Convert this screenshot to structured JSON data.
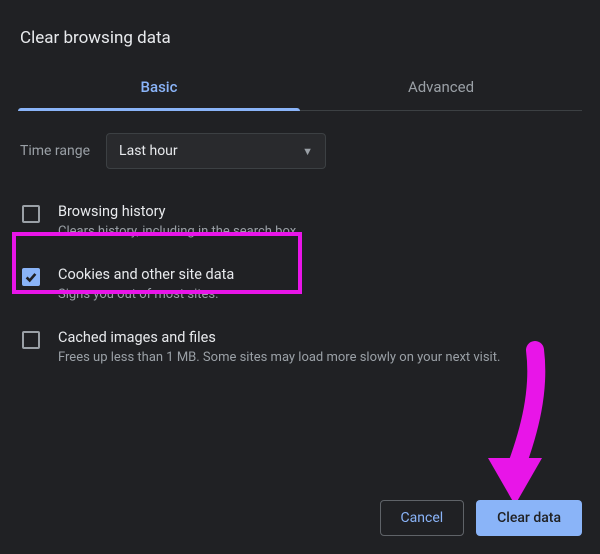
{
  "dialog": {
    "title": "Clear browsing data",
    "tabs": {
      "basic": "Basic",
      "advanced": "Advanced",
      "active": "basic"
    },
    "time_range": {
      "label": "Time range",
      "selected": "Last hour"
    },
    "options": [
      {
        "id": "browsing-history",
        "checked": false,
        "title": "Browsing history",
        "desc": "Clears history, including in the search box"
      },
      {
        "id": "cookies",
        "checked": true,
        "title": "Cookies and other site data",
        "desc": "Signs you out of most sites."
      },
      {
        "id": "cache",
        "checked": false,
        "title": "Cached images and files",
        "desc": "Frees up less than 1 MB. Some sites may load more slowly on your next visit."
      }
    ],
    "buttons": {
      "cancel": "Cancel",
      "clear": "Clear data"
    }
  },
  "annotation": {
    "highlight_color": "#e815e8",
    "arrow_color": "#e815e8"
  }
}
